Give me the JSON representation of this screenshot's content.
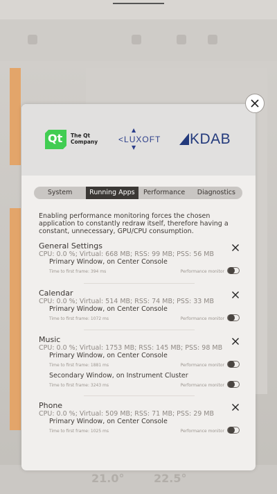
{
  "modal": {
    "logos": {
      "qt_symbol": "Qt",
      "qt_company_line1": "The Qt",
      "qt_company_line2": "Company",
      "luxoft": "LUXOFT",
      "kdab": "KDAB"
    },
    "tabs": [
      {
        "label": "System"
      },
      {
        "label": "Running Apps",
        "active": true
      },
      {
        "label": "Performance"
      },
      {
        "label": "Diagnostics"
      }
    ],
    "intro": "Enabling performance monitoring forces the chosen application  to constantly redraw itself, therefore having a constant, unnecessary, GPU/CPU consumption.",
    "perf_monitor_label": "Performance monitor",
    "apps": [
      {
        "name": "General Settings",
        "stats": "CPU: 0.0 %; Virtual: 668 MB; RSS: 99 MB; PSS: 56 MB",
        "windows": [
          {
            "name": "Primary Window, on Center Console",
            "ttf": "Time to first frame: 394 ms"
          }
        ]
      },
      {
        "name": "Calendar",
        "stats": "CPU: 0.0 %; Virtual: 514 MB; RSS: 74 MB; PSS: 33 MB",
        "windows": [
          {
            "name": "Primary Window, on Center Console",
            "ttf": "Time to first frame: 1072 ms"
          }
        ]
      },
      {
        "name": "Music",
        "stats": "CPU: 0.0 %; Virtual: 1753 MB; RSS: 145 MB; PSS: 98 MB",
        "windows": [
          {
            "name": "Primary Window, on Center Console",
            "ttf": "Time to first frame: 1881 ms"
          },
          {
            "name": "Secondary Window, on Instrument Cluster",
            "ttf": "Time to first frame: 3243 ms"
          }
        ]
      },
      {
        "name": "Phone",
        "stats": "CPU: 0.0 %; Virtual: 509 MB; RSS: 71 MB; PSS: 29 MB",
        "windows": [
          {
            "name": "Primary Window, on Center Console",
            "ttf": "Time to first frame: 1025 ms"
          }
        ]
      }
    ]
  },
  "background": {
    "temp_left": "21.0°",
    "temp_right": "22.5°"
  },
  "colors": {
    "accent_orange": "#e3a56a",
    "tab_active": "#3b3835",
    "qt_green": "#41cd52",
    "luxoft_blue": "#2c3e8a",
    "kdab_blue": "#233a7c"
  }
}
